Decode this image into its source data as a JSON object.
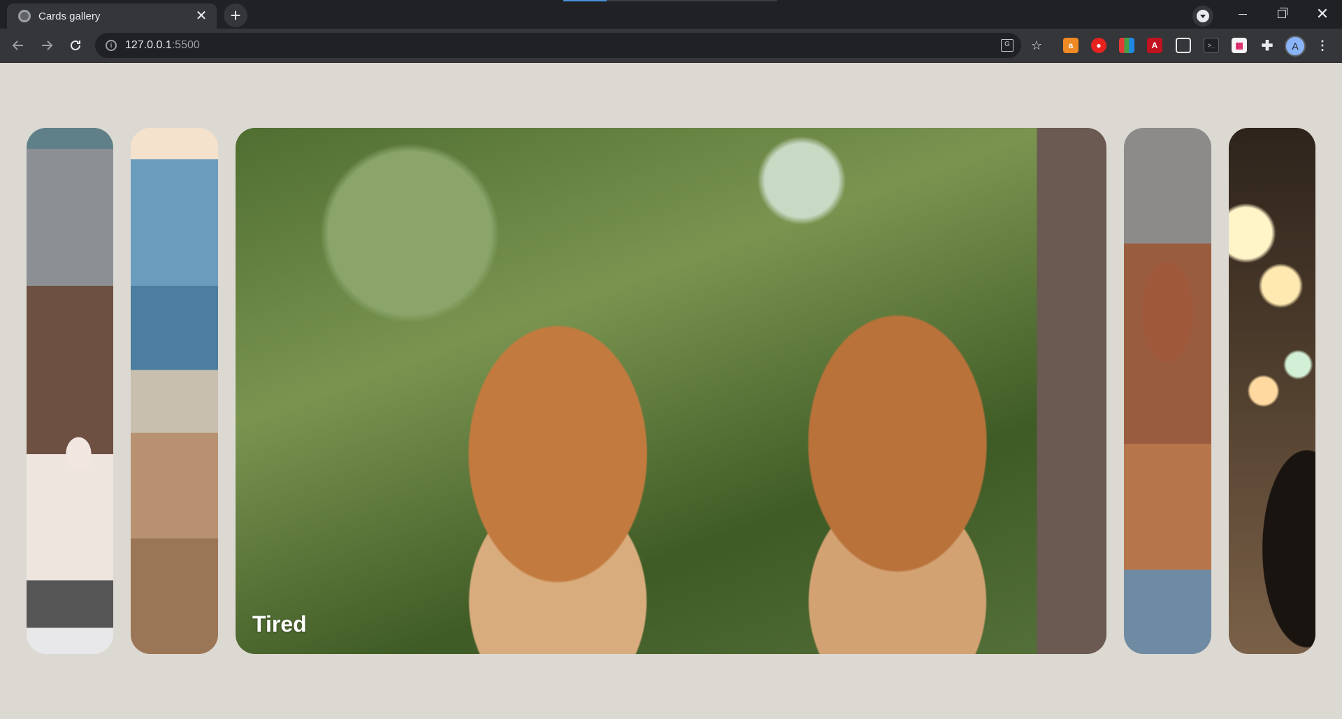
{
  "browser": {
    "tab": {
      "title": "Cards gallery",
      "close_glyph": "✕"
    },
    "new_tab_glyph": "+",
    "window_controls": {
      "close_glyph": "✕"
    },
    "address": {
      "host": "127.0.0.1",
      "port": ":5500"
    },
    "profile_initial": "A"
  },
  "gallery": {
    "cards": [
      {
        "name": "birthday-cake-dog"
      },
      {
        "name": "beach-sand"
      },
      {
        "name": "two-long-haired-dachshunds",
        "caption": "Tired",
        "active": true
      },
      {
        "name": "brown-dog-closeup"
      },
      {
        "name": "black-dog-bokeh-lights"
      }
    ]
  }
}
